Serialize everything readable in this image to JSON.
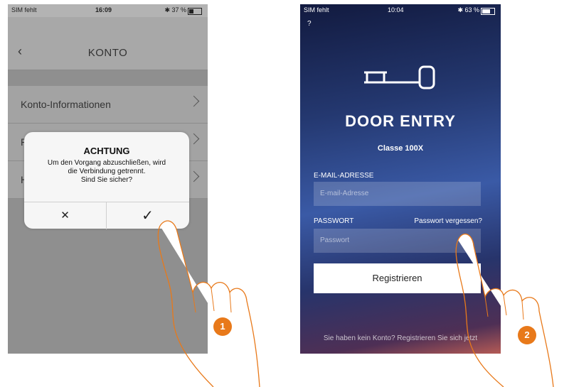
{
  "phone1": {
    "status": {
      "carrier": "SIM fehlt",
      "time": "16:09",
      "battery": "✱ 37 %"
    },
    "nav": {
      "back_icon": "‹",
      "title": "KONTO"
    },
    "list": [
      {
        "label": "Konto-Informationen"
      },
      {
        "label": "P"
      },
      {
        "label": "H"
      }
    ],
    "dialog": {
      "title": "ACHTUNG",
      "line1": "Um den Vorgang abzuschließen, wird",
      "line2": "die Verbindung getrennt.",
      "line3": "Sind Sie sicher?",
      "cancel": "✕",
      "confirm": "✓"
    },
    "badge": "1"
  },
  "phone2": {
    "status": {
      "carrier": "SIM fehlt",
      "time": "10:04",
      "battery": "✱ 63 %"
    },
    "help": "?",
    "title": "DOOR ENTRY",
    "subtitle": "Classe 100X",
    "email_label": "E-MAIL-ADRESSE",
    "email_placeholder": "E-mail-Adresse",
    "password_label": "PASSWORT",
    "forgot": "Passwort vergessen?",
    "password_placeholder": "Passwort",
    "register_button": "Registrieren",
    "bottom_link": "Sie haben kein Konto? Registrieren Sie sich jetzt",
    "badge": "2"
  },
  "colors": {
    "badge": "#e8791a",
    "overlay_gray": "#8f8f8f"
  }
}
